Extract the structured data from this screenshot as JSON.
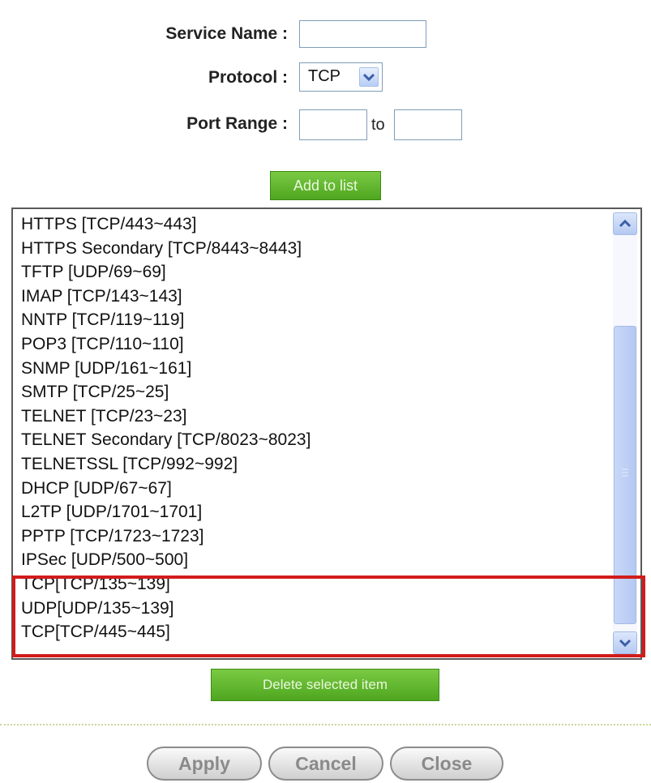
{
  "form": {
    "service_name_label": "Service Name :",
    "service_name_value": "",
    "protocol_label": "Protocol :",
    "protocol_value": "TCP",
    "port_range_label": "Port Range :",
    "port_from": "",
    "port_to": "",
    "to_label": "to",
    "add_button": "Add to list"
  },
  "services": [
    "HTTPS [TCP/443~443]",
    "HTTPS Secondary [TCP/8443~8443]",
    "TFTP [UDP/69~69]",
    "IMAP [TCP/143~143]",
    "NNTP [TCP/119~119]",
    "POP3 [TCP/110~110]",
    "SNMP [UDP/161~161]",
    "SMTP [TCP/25~25]",
    "TELNET [TCP/23~23]",
    "TELNET Secondary [TCP/8023~8023]",
    "TELNETSSL [TCP/992~992]",
    "DHCP [UDP/67~67]",
    "L2TP [UDP/1701~1701]",
    "PPTP [TCP/1723~1723]",
    "IPSec [UDP/500~500]",
    "TCP[TCP/135~139]",
    "UDP[UDP/135~139]",
    "TCP[TCP/445~445]"
  ],
  "delete_button": "Delete selected item",
  "footer": {
    "apply": "Apply",
    "cancel": "Cancel",
    "close": "Close"
  },
  "colors": {
    "highlight": "#d21b1b",
    "button_green": "#5db52a"
  }
}
